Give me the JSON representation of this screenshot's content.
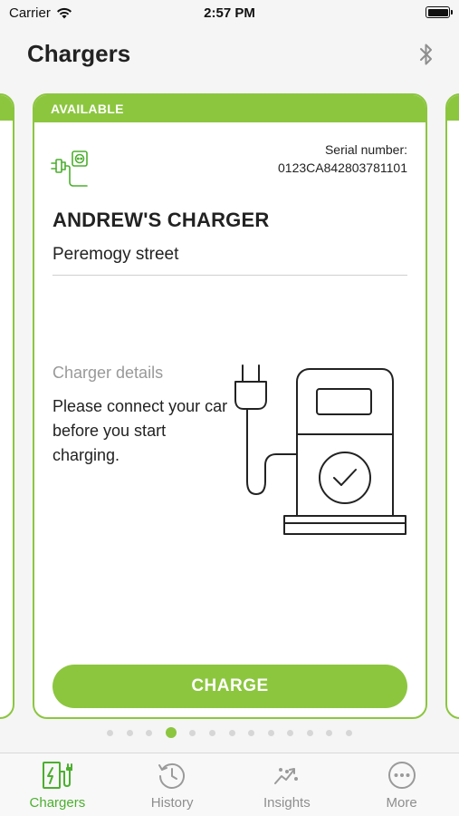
{
  "status_bar": {
    "carrier": "Carrier",
    "time": "2:57 PM"
  },
  "header": {
    "title": "Chargers",
    "bluetooth_icon": "bluetooth-icon"
  },
  "card": {
    "status": "AVAILABLE",
    "serial_label": "Serial number:",
    "serial_value": "0123CA842803781101",
    "name": "ANDREW'S CHARGER",
    "address": "Peremogy street",
    "details_title": "Charger details",
    "details_text": "Please connect your car before you start charging.",
    "button_label": "CHARGE",
    "accent_color": "#8cc63f"
  },
  "pagination": {
    "total": 13,
    "active_index": 3
  },
  "tabs": [
    {
      "label": "Chargers",
      "icon": "charger-icon",
      "active": true
    },
    {
      "label": "History",
      "icon": "history-icon",
      "active": false
    },
    {
      "label": "Insights",
      "icon": "insights-icon",
      "active": false
    },
    {
      "label": "More",
      "icon": "more-icon",
      "active": false
    }
  ]
}
